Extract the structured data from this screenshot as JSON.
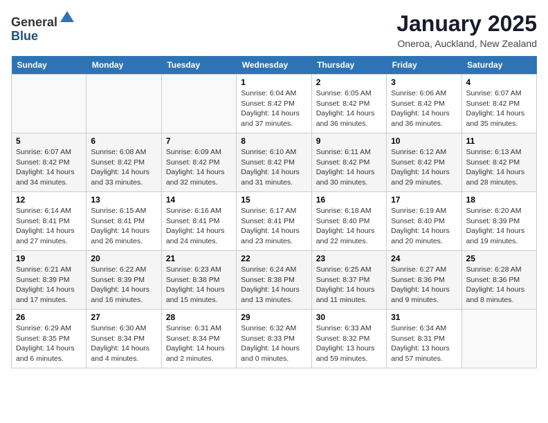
{
  "header": {
    "logo_general": "General",
    "logo_blue": "Blue",
    "month_title": "January 2025",
    "location": "Oneroa, Auckland, New Zealand"
  },
  "days_of_week": [
    "Sunday",
    "Monday",
    "Tuesday",
    "Wednesday",
    "Thursday",
    "Friday",
    "Saturday"
  ],
  "weeks": [
    [
      {
        "day": "",
        "info": ""
      },
      {
        "day": "",
        "info": ""
      },
      {
        "day": "",
        "info": ""
      },
      {
        "day": "1",
        "info": "Sunrise: 6:04 AM\nSunset: 8:42 PM\nDaylight: 14 hours\nand 37 minutes."
      },
      {
        "day": "2",
        "info": "Sunrise: 6:05 AM\nSunset: 8:42 PM\nDaylight: 14 hours\nand 36 minutes."
      },
      {
        "day": "3",
        "info": "Sunrise: 6:06 AM\nSunset: 8:42 PM\nDaylight: 14 hours\nand 36 minutes."
      },
      {
        "day": "4",
        "info": "Sunrise: 6:07 AM\nSunset: 8:42 PM\nDaylight: 14 hours\nand 35 minutes."
      }
    ],
    [
      {
        "day": "5",
        "info": "Sunrise: 6:07 AM\nSunset: 8:42 PM\nDaylight: 14 hours\nand 34 minutes."
      },
      {
        "day": "6",
        "info": "Sunrise: 6:08 AM\nSunset: 8:42 PM\nDaylight: 14 hours\nand 33 minutes."
      },
      {
        "day": "7",
        "info": "Sunrise: 6:09 AM\nSunset: 8:42 PM\nDaylight: 14 hours\nand 32 minutes."
      },
      {
        "day": "8",
        "info": "Sunrise: 6:10 AM\nSunset: 8:42 PM\nDaylight: 14 hours\nand 31 minutes."
      },
      {
        "day": "9",
        "info": "Sunrise: 6:11 AM\nSunset: 8:42 PM\nDaylight: 14 hours\nand 30 minutes."
      },
      {
        "day": "10",
        "info": "Sunrise: 6:12 AM\nSunset: 8:42 PM\nDaylight: 14 hours\nand 29 minutes."
      },
      {
        "day": "11",
        "info": "Sunrise: 6:13 AM\nSunset: 8:42 PM\nDaylight: 14 hours\nand 28 minutes."
      }
    ],
    [
      {
        "day": "12",
        "info": "Sunrise: 6:14 AM\nSunset: 8:41 PM\nDaylight: 14 hours\nand 27 minutes."
      },
      {
        "day": "13",
        "info": "Sunrise: 6:15 AM\nSunset: 8:41 PM\nDaylight: 14 hours\nand 26 minutes."
      },
      {
        "day": "14",
        "info": "Sunrise: 6:16 AM\nSunset: 8:41 PM\nDaylight: 14 hours\nand 24 minutes."
      },
      {
        "day": "15",
        "info": "Sunrise: 6:17 AM\nSunset: 8:41 PM\nDaylight: 14 hours\nand 23 minutes."
      },
      {
        "day": "16",
        "info": "Sunrise: 6:18 AM\nSunset: 8:40 PM\nDaylight: 14 hours\nand 22 minutes."
      },
      {
        "day": "17",
        "info": "Sunrise: 6:19 AM\nSunset: 8:40 PM\nDaylight: 14 hours\nand 20 minutes."
      },
      {
        "day": "18",
        "info": "Sunrise: 6:20 AM\nSunset: 8:39 PM\nDaylight: 14 hours\nand 19 minutes."
      }
    ],
    [
      {
        "day": "19",
        "info": "Sunrise: 6:21 AM\nSunset: 8:39 PM\nDaylight: 14 hours\nand 17 minutes."
      },
      {
        "day": "20",
        "info": "Sunrise: 6:22 AM\nSunset: 8:39 PM\nDaylight: 14 hours\nand 16 minutes."
      },
      {
        "day": "21",
        "info": "Sunrise: 6:23 AM\nSunset: 8:38 PM\nDaylight: 14 hours\nand 15 minutes."
      },
      {
        "day": "22",
        "info": "Sunrise: 6:24 AM\nSunset: 8:38 PM\nDaylight: 14 hours\nand 13 minutes."
      },
      {
        "day": "23",
        "info": "Sunrise: 6:25 AM\nSunset: 8:37 PM\nDaylight: 14 hours\nand 11 minutes."
      },
      {
        "day": "24",
        "info": "Sunrise: 6:27 AM\nSunset: 8:36 PM\nDaylight: 14 hours\nand 9 minutes."
      },
      {
        "day": "25",
        "info": "Sunrise: 6:28 AM\nSunset: 8:36 PM\nDaylight: 14 hours\nand 8 minutes."
      }
    ],
    [
      {
        "day": "26",
        "info": "Sunrise: 6:29 AM\nSunset: 8:35 PM\nDaylight: 14 hours\nand 6 minutes."
      },
      {
        "day": "27",
        "info": "Sunrise: 6:30 AM\nSunset: 8:34 PM\nDaylight: 14 hours\nand 4 minutes."
      },
      {
        "day": "28",
        "info": "Sunrise: 6:31 AM\nSunset: 8:34 PM\nDaylight: 14 hours\nand 2 minutes."
      },
      {
        "day": "29",
        "info": "Sunrise: 6:32 AM\nSunset: 8:33 PM\nDaylight: 14 hours\nand 0 minutes."
      },
      {
        "day": "30",
        "info": "Sunrise: 6:33 AM\nSunset: 8:32 PM\nDaylight: 13 hours\nand 59 minutes."
      },
      {
        "day": "31",
        "info": "Sunrise: 6:34 AM\nSunset: 8:31 PM\nDaylight: 13 hours\nand 57 minutes."
      },
      {
        "day": "",
        "info": ""
      }
    ]
  ]
}
